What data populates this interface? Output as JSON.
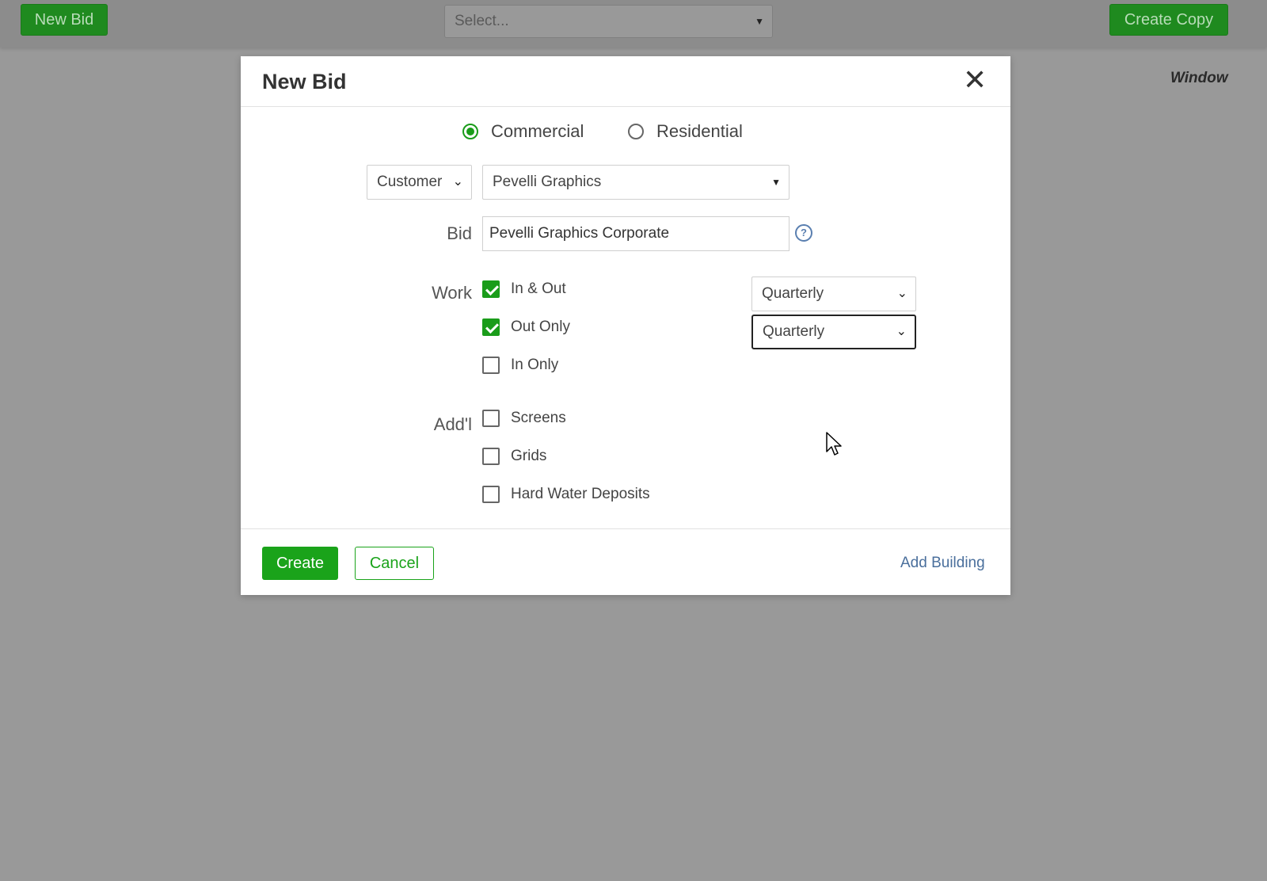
{
  "topbar": {
    "new_bid_label": "New Bid",
    "select_placeholder": "Select...",
    "create_copy_label": "Create Copy",
    "window_label": "Window"
  },
  "modal": {
    "title": "New Bid",
    "close_icon": "close-icon",
    "property_type": {
      "options": [
        "Commercial",
        "Residential"
      ],
      "selected": "Commercial"
    },
    "customer_select_value": "Customer",
    "company_select_value": "Pevelli Graphics",
    "bid_label": "Bid",
    "bid_value": "Pevelli Graphics Corporate",
    "help_icon": "question-circle-icon",
    "work_label": "Work",
    "work_options": [
      {
        "label": "In & Out",
        "checked": true,
        "frequency": "Quarterly"
      },
      {
        "label": "Out Only",
        "checked": true,
        "frequency": "Quarterly"
      },
      {
        "label": "In Only",
        "checked": false
      }
    ],
    "addl_label": "Add'l",
    "addl_options": [
      {
        "label": "Screens",
        "checked": false
      },
      {
        "label": "Grids",
        "checked": false
      },
      {
        "label": "Hard Water Deposits",
        "checked": false
      }
    ],
    "footer": {
      "create_label": "Create",
      "cancel_label": "Cancel",
      "add_building_label": "Add Building"
    }
  },
  "colors": {
    "accent_green": "#1aa31a",
    "link_blue": "#4a6f9c",
    "overlay_gray": "#999999"
  }
}
